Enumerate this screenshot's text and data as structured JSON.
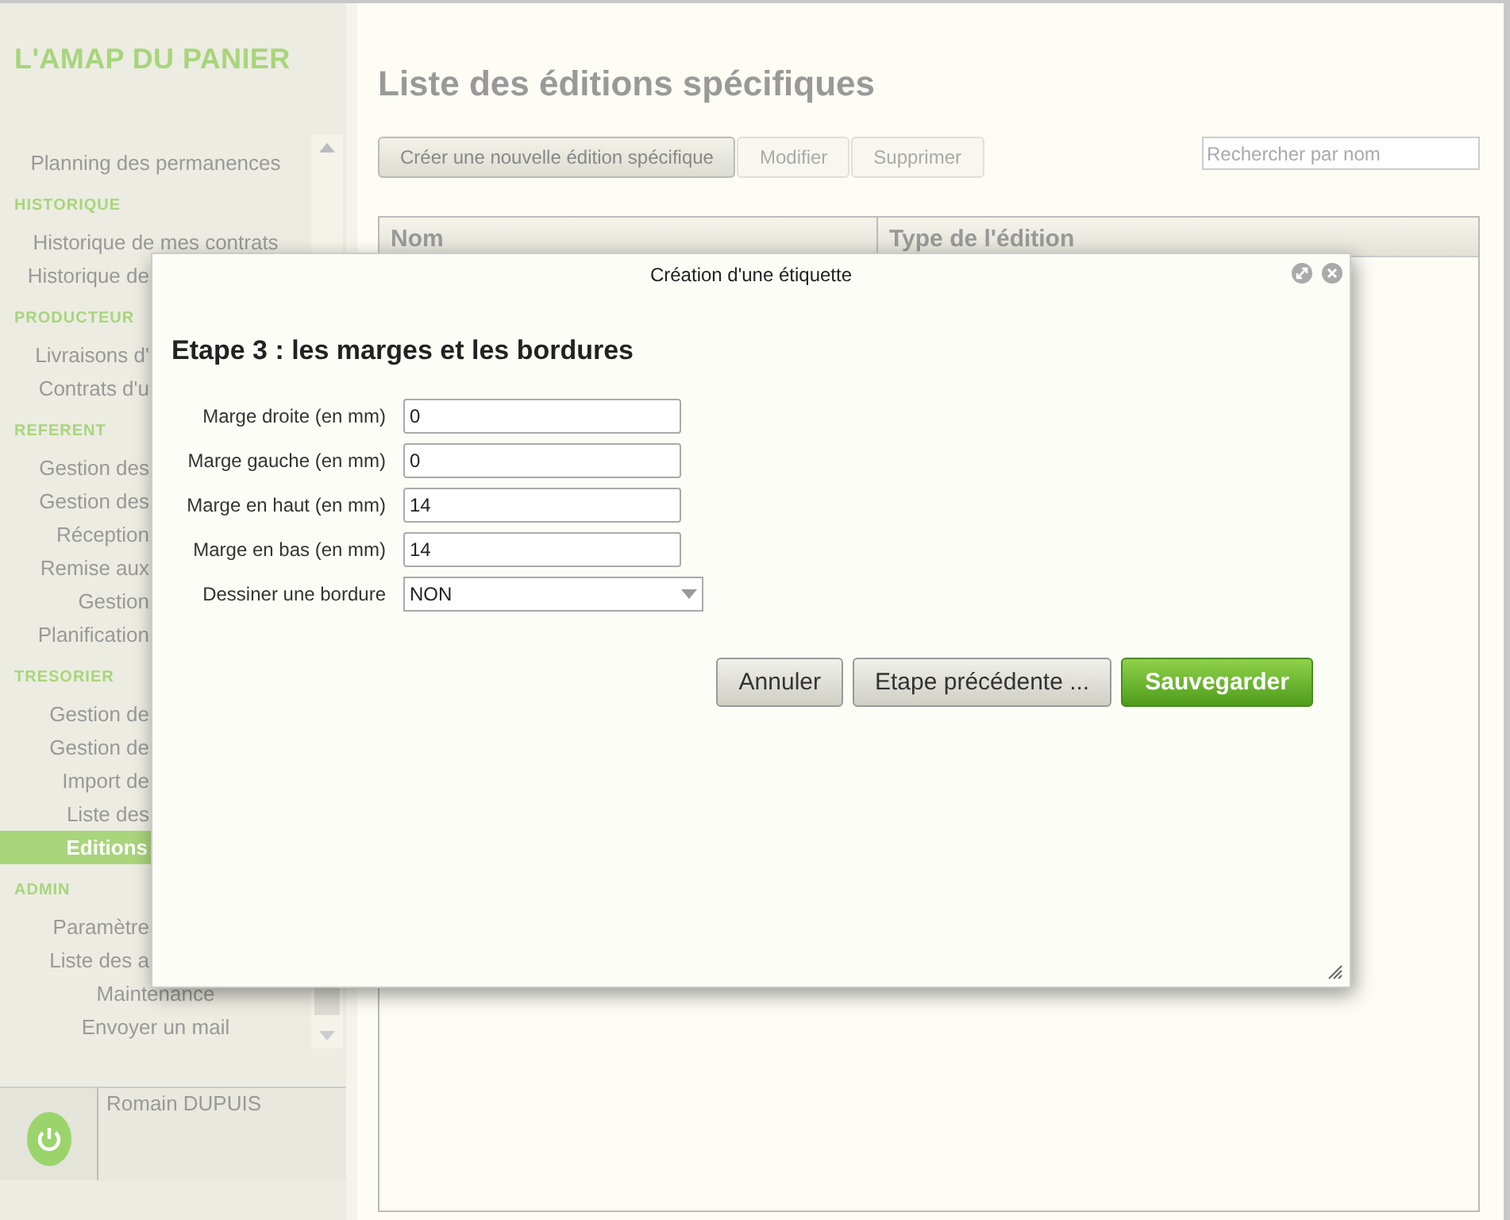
{
  "app": {
    "logo": "L'AMAP DU PANIER"
  },
  "sidebar": {
    "items": [
      {
        "kind": "item",
        "label": "Planning des permanences",
        "selected": false
      },
      {
        "kind": "section",
        "label": "HISTORIQUE"
      },
      {
        "kind": "item",
        "label": "Historique de mes contrats",
        "selected": false
      },
      {
        "kind": "covered",
        "label": "Historique de",
        "selected": false
      },
      {
        "kind": "section",
        "label": "PRODUCTEUR"
      },
      {
        "kind": "covered",
        "label": "Livraisons d'",
        "selected": false
      },
      {
        "kind": "covered",
        "label": "Contrats d'u",
        "selected": false
      },
      {
        "kind": "section",
        "label": "REFERENT"
      },
      {
        "kind": "covered",
        "label": "Gestion des",
        "selected": false
      },
      {
        "kind": "covered",
        "label": "Gestion des",
        "selected": false
      },
      {
        "kind": "covered",
        "label": "Réception",
        "selected": false
      },
      {
        "kind": "covered",
        "label": "Remise aux",
        "selected": false
      },
      {
        "kind": "covered",
        "label": "Gestion",
        "selected": false
      },
      {
        "kind": "covered",
        "label": "Planification",
        "selected": false
      },
      {
        "kind": "section",
        "label": "TRESORIER"
      },
      {
        "kind": "covered",
        "label": "Gestion de",
        "selected": false
      },
      {
        "kind": "covered",
        "label": "Gestion de",
        "selected": false
      },
      {
        "kind": "covered",
        "label": "Import de",
        "selected": false
      },
      {
        "kind": "covered",
        "label": "Liste des",
        "selected": false
      },
      {
        "kind": "covered",
        "label": "Editions",
        "selected": true
      },
      {
        "kind": "section",
        "label": "ADMIN"
      },
      {
        "kind": "covered",
        "label": "Paramètre",
        "selected": false
      },
      {
        "kind": "covered",
        "label": "Liste des a",
        "selected": false
      },
      {
        "kind": "item",
        "label": "Maintenance",
        "selected": false
      },
      {
        "kind": "item",
        "label": "Envoyer un mail",
        "selected": false
      }
    ],
    "user": {
      "name": "Romain DUPUIS"
    }
  },
  "main": {
    "title": "Liste des éditions spécifiques",
    "buttons": [
      {
        "label": "Créer une nouvelle édition spécifique",
        "disabled": false
      },
      {
        "label": "Modifier",
        "disabled": true
      },
      {
        "label": "Supprimer",
        "disabled": true
      }
    ],
    "search": {
      "placeholder": "Rechercher par nom"
    },
    "table": {
      "columns": [
        "Nom",
        "Type de l'édition"
      ]
    }
  },
  "dialog": {
    "title": "Création d'une étiquette",
    "heading": "Etape 3 : les marges et les bordures",
    "fields": [
      {
        "kind": "text",
        "label": "Marge droite (en mm)",
        "value": "0"
      },
      {
        "kind": "text",
        "label": "Marge gauche (en mm)",
        "value": "0"
      },
      {
        "kind": "text",
        "label": "Marge en haut (en mm)",
        "value": "14"
      },
      {
        "kind": "text",
        "label": "Marge en bas (en mm)",
        "value": "14"
      },
      {
        "kind": "select",
        "label": "Dessiner une bordure",
        "value": "NON"
      }
    ],
    "buttons": [
      {
        "kind": "plain",
        "label": "Annuler"
      },
      {
        "kind": "plain",
        "label": "Etape précédente ..."
      },
      {
        "kind": "primary",
        "label": "Sauvegarder"
      }
    ]
  }
}
